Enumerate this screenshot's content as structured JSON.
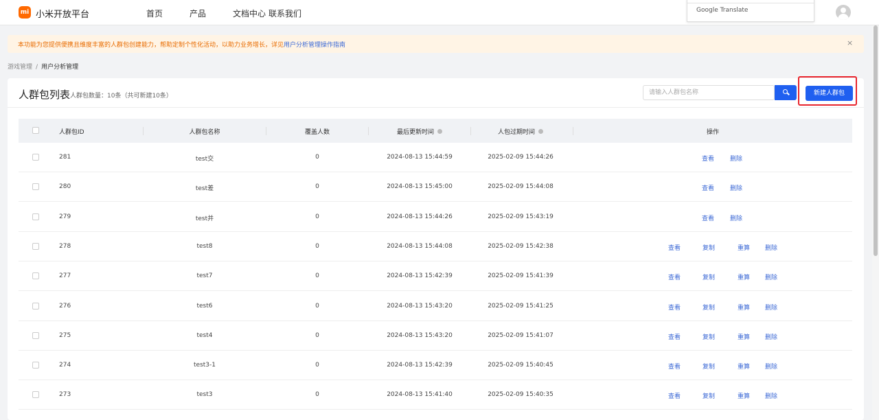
{
  "nav": {
    "logo": "mi",
    "brand": "小米开放平台",
    "links": [
      "首页",
      "产品",
      "文档中心",
      "联系我们"
    ],
    "translate_label": "Google Translate"
  },
  "notice": {
    "text": "本功能为您提供便携且维度丰富的人群包创建能力，帮助定制个性化活动，以助力业务增长，详见",
    "link": "用户分析管理操作指南",
    "close": "×"
  },
  "breadcrumb": [
    "游戏管理",
    "用户分析管理"
  ],
  "panel": {
    "title": "人群包列表",
    "subtitle": "人群包数量：10条（共可新建10条）",
    "search_placeholder": "请输入人群包名称",
    "new_button": "新建人群包"
  },
  "table": {
    "columns": [
      "人群包ID",
      "人群包名称",
      "覆盖人数",
      "最后更新时间",
      "人包过期时间",
      "操作"
    ],
    "rows": [
      {
        "id": "281",
        "name": "test交",
        "count": "0",
        "updated": "2024-08-13 15:44:59",
        "expires": "2025-02-09 15:44:26",
        "actions": [
          "查看",
          "删除"
        ]
      },
      {
        "id": "280",
        "name": "test差",
        "count": "0",
        "updated": "2024-08-13 15:45:00",
        "expires": "2025-02-09 15:44:08",
        "actions": [
          "查看",
          "删除"
        ]
      },
      {
        "id": "279",
        "name": "test并",
        "count": "0",
        "updated": "2024-08-13 15:44:26",
        "expires": "2025-02-09 15:43:19",
        "actions": [
          "查看",
          "删除"
        ]
      },
      {
        "id": "278",
        "name": "test8",
        "count": "0",
        "updated": "2024-08-13 15:44:08",
        "expires": "2025-02-09 15:42:38",
        "actions": [
          "查看",
          "复制",
          "重算",
          "删除"
        ]
      },
      {
        "id": "277",
        "name": "test7",
        "count": "0",
        "updated": "2024-08-13 15:42:39",
        "expires": "2025-02-09 15:41:39",
        "actions": [
          "查看",
          "复制",
          "重算",
          "删除"
        ]
      },
      {
        "id": "276",
        "name": "test6",
        "count": "0",
        "updated": "2024-08-13 15:43:20",
        "expires": "2025-02-09 15:41:25",
        "actions": [
          "查看",
          "复制",
          "重算",
          "删除"
        ]
      },
      {
        "id": "275",
        "name": "test4",
        "count": "0",
        "updated": "2024-08-13 15:43:20",
        "expires": "2025-02-09 15:41:07",
        "actions": [
          "查看",
          "复制",
          "重算",
          "删除"
        ]
      },
      {
        "id": "274",
        "name": "test3-1",
        "count": "0",
        "updated": "2024-08-13 15:42:39",
        "expires": "2025-02-09 15:40:45",
        "actions": [
          "查看",
          "复制",
          "重算",
          "删除"
        ]
      },
      {
        "id": "273",
        "name": "test3",
        "count": "0",
        "updated": "2024-08-13 15:41:40",
        "expires": "2025-02-09 15:40:35",
        "actions": [
          "查看",
          "复制",
          "重算",
          "删除"
        ]
      }
    ]
  },
  "colors": {
    "accent": "#1f5ff0",
    "link": "#3d6ad6",
    "brand": "#ff6900",
    "notice_bg": "#fff4e5",
    "notice_text": "#e86b00",
    "highlight": "#e8242c"
  }
}
